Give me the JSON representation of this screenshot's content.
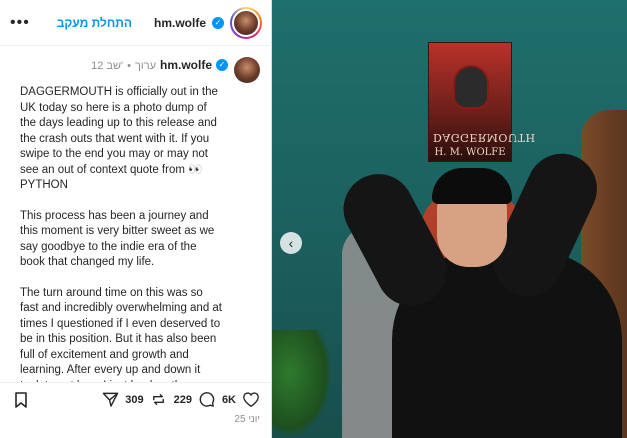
{
  "header": {
    "username": "hm.wolfe",
    "follow_label": "התחלת מעקב",
    "more_label": "•••"
  },
  "caption": {
    "username": "hm.wolfe",
    "edited_label": "ערוך",
    "separator": "•",
    "age": "12 שב'",
    "paragraphs": [
      "DAGGERMOUTH is officially out in the UK today so here is a photo dump of the days leading up to this release and the crash outs that went with it. If you swipe to the end you may or may not see an out of context quote from 👀 PYTHON",
      "This process has been a journey and this moment is very bitter sweet as we say goodbye to the indie era of the book that changed my life.",
      "The turn around time on this was so fast and incredibly overwhelming and at times I questioned if I even deserved to be in this position. But it has also been full of excitement and growth and learning. After every up and down it took to get here I just land on the feeling of gratitude"
    ]
  },
  "book": {
    "title": "DAGGERMOUTH",
    "author": "H. M. WOLFE"
  },
  "actions": {
    "likes": "6K",
    "comments": "229",
    "reposts": "309"
  },
  "date": "25 יוני",
  "colors": {
    "accent": "#0095f6",
    "text": "#262626",
    "muted": "#8e8e8e",
    "wall": "#1f6f6c"
  },
  "icons": [
    "more-icon",
    "verified-icon",
    "heart-icon",
    "comment-icon",
    "repost-icon",
    "share-icon",
    "bookmark-icon",
    "chevron-left-icon"
  ]
}
